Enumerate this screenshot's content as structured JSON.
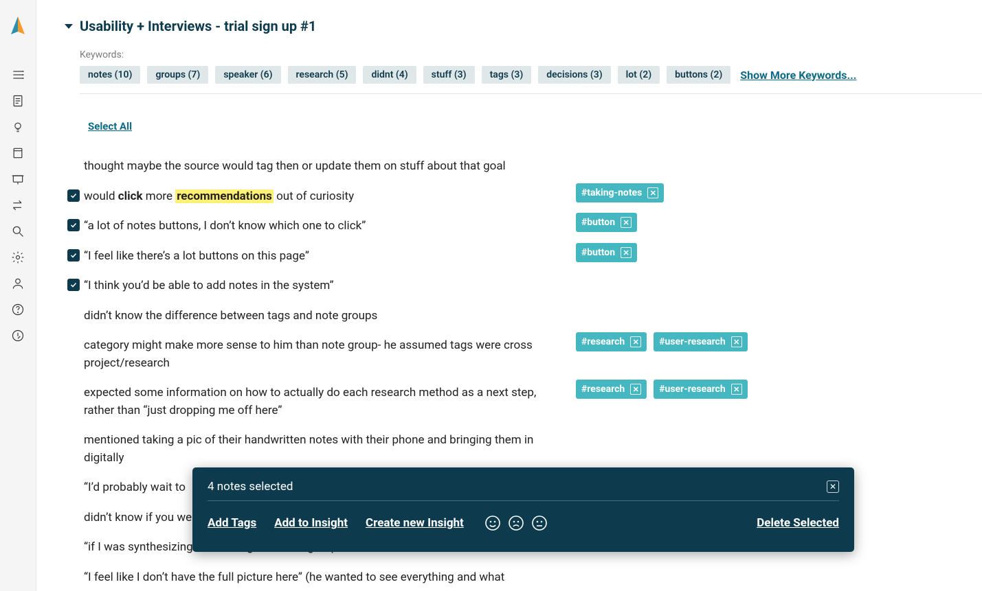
{
  "project_title": "Usability + Interviews - trial sign up #1",
  "keywords_label": "Keywords:",
  "keywords": [
    {
      "label": "notes",
      "count": 10
    },
    {
      "label": "groups",
      "count": 7
    },
    {
      "label": "speaker",
      "count": 6
    },
    {
      "label": "research",
      "count": 5
    },
    {
      "label": "didnt",
      "count": 4
    },
    {
      "label": "stuff",
      "count": 3
    },
    {
      "label": "tags",
      "count": 3
    },
    {
      "label": "decisions",
      "count": 3
    },
    {
      "label": "lot",
      "count": 2
    },
    {
      "label": "buttons",
      "count": 2
    }
  ],
  "show_more": "Show More Keywords...",
  "select_all": "Select All",
  "notes": [
    {
      "checked": false,
      "pre": "thought maybe the source would tag then or update them on stuff about that goal",
      "tags": []
    },
    {
      "checked": true,
      "pre": "would ",
      "bold": "click",
      "mid": " more ",
      "highlight": "recommendations",
      "post": " out of curiosity",
      "tags": [
        "#taking-notes"
      ]
    },
    {
      "checked": true,
      "pre": "“a lot of notes buttons, I don’t know which one to click”",
      "tags": [
        "#button"
      ]
    },
    {
      "checked": true,
      "pre": "“I feel like there’s a lot buttons on this page”",
      "tags": [
        "#button"
      ]
    },
    {
      "checked": true,
      "pre": "“I think you’d be able to add notes in the system”",
      "tags": []
    },
    {
      "checked": false,
      "pre": "didn’t know the difference between tags and note groups",
      "tags": []
    },
    {
      "checked": false,
      "pre": "category might make more sense to him than note group- he assumed tags were cross project/research",
      "tags": [
        "#research",
        "#user-research"
      ]
    },
    {
      "checked": false,
      "pre": "expected some information on how to actually do each research method as a next step, rather than “just dropping me off here”",
      "tags": [
        "#research",
        "#user-research"
      ]
    },
    {
      "checked": false,
      "pre": "mentioned taking a pic of their handwritten notes with their phone and bringing them in digitally",
      "tags": []
    },
    {
      "checked": false,
      "pre": "“I’d probably wait to",
      "tags": []
    },
    {
      "checked": false,
      "pre": "didn’t know if you we",
      "tags": []
    },
    {
      "checked": false,
      "pre": "“if I was synthesizing them, I might use the groups...",
      "tags": []
    },
    {
      "checked": false,
      "pre": "“I feel like I don’t have the full picture here” (he wanted to see everything and what",
      "tags": []
    }
  ],
  "toolbar": {
    "count_text": "4 notes selected",
    "add_tags": "Add Tags",
    "add_to_insight": "Add to Insight",
    "create_insight": "Create new Insight",
    "delete": "Delete Selected"
  }
}
